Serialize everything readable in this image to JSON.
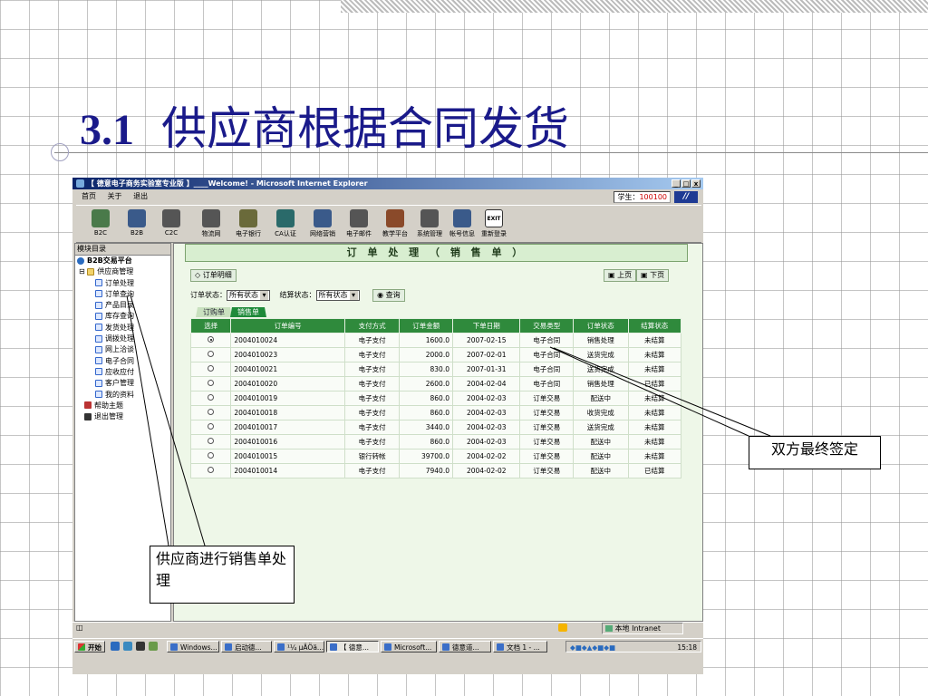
{
  "slide": {
    "number": "3.1",
    "title": "供应商根据合同发货",
    "callout_right": "双方最终签定",
    "callout_left": "供应商进行销售单处理"
  },
  "window": {
    "title": "【 德意电子商务实验室专业版 】____Welcome! - Microsoft Internet Explorer",
    "controls": [
      "_",
      "□",
      "x"
    ],
    "menu": [
      "首页",
      "关于",
      "退出"
    ],
    "student_label": "学生：",
    "student_id": "100100",
    "toolbar": [
      {
        "label": "B2C",
        "icon": "b2c-icon"
      },
      {
        "label": "B2B",
        "icon": "b2b-icon"
      },
      {
        "label": "C2C",
        "icon": "c2c-icon"
      },
      {
        "label": "物流网",
        "icon": "logistics-icon"
      },
      {
        "label": "电子银行",
        "icon": "bank-icon"
      },
      {
        "label": "CA认证",
        "icon": "ca-icon"
      },
      {
        "label": "网络营销",
        "icon": "marketing-icon"
      },
      {
        "label": "电子邮件",
        "icon": "email-icon"
      },
      {
        "label": "教学平台",
        "icon": "teaching-icon"
      },
      {
        "label": "系统管理",
        "icon": "system-icon"
      },
      {
        "label": "帐号信息",
        "icon": "account-icon"
      },
      {
        "label": "重新登录",
        "icon": "exit-icon"
      }
    ],
    "exit_badge": "EXIT"
  },
  "sidebar": {
    "header": "模块目录",
    "root": "B2B交易平台",
    "group": "供应商管理",
    "items": [
      "订单处理",
      "订单查询",
      "产品目录",
      "库存查询",
      "发货处理",
      "调拨处理",
      "网上洽谈",
      "电子合同",
      "应收应付",
      "客户管理",
      "我的资料"
    ],
    "help": "帮助主题",
    "exit": "退出管理"
  },
  "content": {
    "heading": "订 单 处 理 （ 销 售 单 ）",
    "detail_button": "订单明细",
    "prev_button": "上页",
    "next_button": "下页",
    "order_status_label": "订单状态：",
    "order_status_value": "所有状态",
    "settle_status_label": "结算状态：",
    "settle_status_value": "所有状态",
    "query_button": "查询",
    "tabs": [
      "订购单",
      "销售单"
    ],
    "columns": [
      "选择",
      "订单编号",
      "支付方式",
      "订单金额",
      "下单日期",
      "交易类型",
      "订单状态",
      "结算状态"
    ],
    "rows": [
      {
        "selected": true,
        "id": "2004010024",
        "pay": "电子支付",
        "amount": "1600.0",
        "date": "2007-02-15",
        "type": "电子合同",
        "status": "销售处理",
        "settle": "未结算"
      },
      {
        "selected": false,
        "id": "2004010023",
        "pay": "电子支付",
        "amount": "2000.0",
        "date": "2007-02-01",
        "type": "电子合同",
        "status": "送货完成",
        "settle": "未结算"
      },
      {
        "selected": false,
        "id": "2004010021",
        "pay": "电子支付",
        "amount": "830.0",
        "date": "2007-01-31",
        "type": "电子合同",
        "status": "送货完成",
        "settle": "未结算"
      },
      {
        "selected": false,
        "id": "2004010020",
        "pay": "电子支付",
        "amount": "2600.0",
        "date": "2004-02-04",
        "type": "电子合同",
        "status": "销售处理",
        "settle": "已结算"
      },
      {
        "selected": false,
        "id": "2004010019",
        "pay": "电子支付",
        "amount": "860.0",
        "date": "2004-02-03",
        "type": "订单交易",
        "status": "配送中",
        "settle": "未结算"
      },
      {
        "selected": false,
        "id": "2004010018",
        "pay": "电子支付",
        "amount": "860.0",
        "date": "2004-02-03",
        "type": "订单交易",
        "status": "收货完成",
        "settle": "未结算"
      },
      {
        "selected": false,
        "id": "2004010017",
        "pay": "电子支付",
        "amount": "3440.0",
        "date": "2004-02-03",
        "type": "订单交易",
        "status": "送货完成",
        "settle": "未结算"
      },
      {
        "selected": false,
        "id": "2004010016",
        "pay": "电子支付",
        "amount": "860.0",
        "date": "2004-02-03",
        "type": "订单交易",
        "status": "配送中",
        "settle": "未结算"
      },
      {
        "selected": false,
        "id": "2004010015",
        "pay": "银行转帐",
        "amount": "39700.0",
        "date": "2004-02-02",
        "type": "订单交易",
        "status": "配送中",
        "settle": "未结算"
      },
      {
        "selected": false,
        "id": "2004010014",
        "pay": "电子支付",
        "amount": "7940.0",
        "date": "2004-02-02",
        "type": "订单交易",
        "status": "配送中",
        "settle": "已结算"
      }
    ]
  },
  "statusbar": {
    "zone": "本地 Intranet"
  },
  "taskbar": {
    "start": "开始",
    "buttons": [
      "Windows...",
      "启动德...",
      "¹¼ µÄÖä...",
      "【 德意...",
      "Microsoft...",
      "德意道...",
      "文档 1 - ..."
    ],
    "clock": "15:18"
  },
  "colors": {
    "title": "#1a1a8a",
    "header_green": "#2f8a3c",
    "content_bg": "#eef7e8"
  }
}
